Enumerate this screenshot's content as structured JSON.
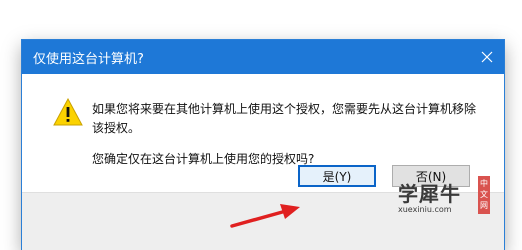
{
  "dialog": {
    "title": "仅使用这台计算机?",
    "message": "如果您将来要在其他计算机上使用这个授权，您需要先从这台计算机移除该授权。",
    "question": "您确定仅在这台计算机上使用您的授权吗?",
    "yes_label": "是(Y)",
    "no_label": "否(N)"
  },
  "watermark": {
    "text": "学犀牛",
    "url": "xuexiniu.com",
    "tag": [
      "中",
      "文",
      "网"
    ]
  },
  "colors": {
    "titlebar": "#1e78d7",
    "arrow": "#e02020",
    "warning_fill": "#fbd200"
  },
  "icons": {
    "warning": "warning-triangle-icon",
    "close": "close-icon"
  }
}
